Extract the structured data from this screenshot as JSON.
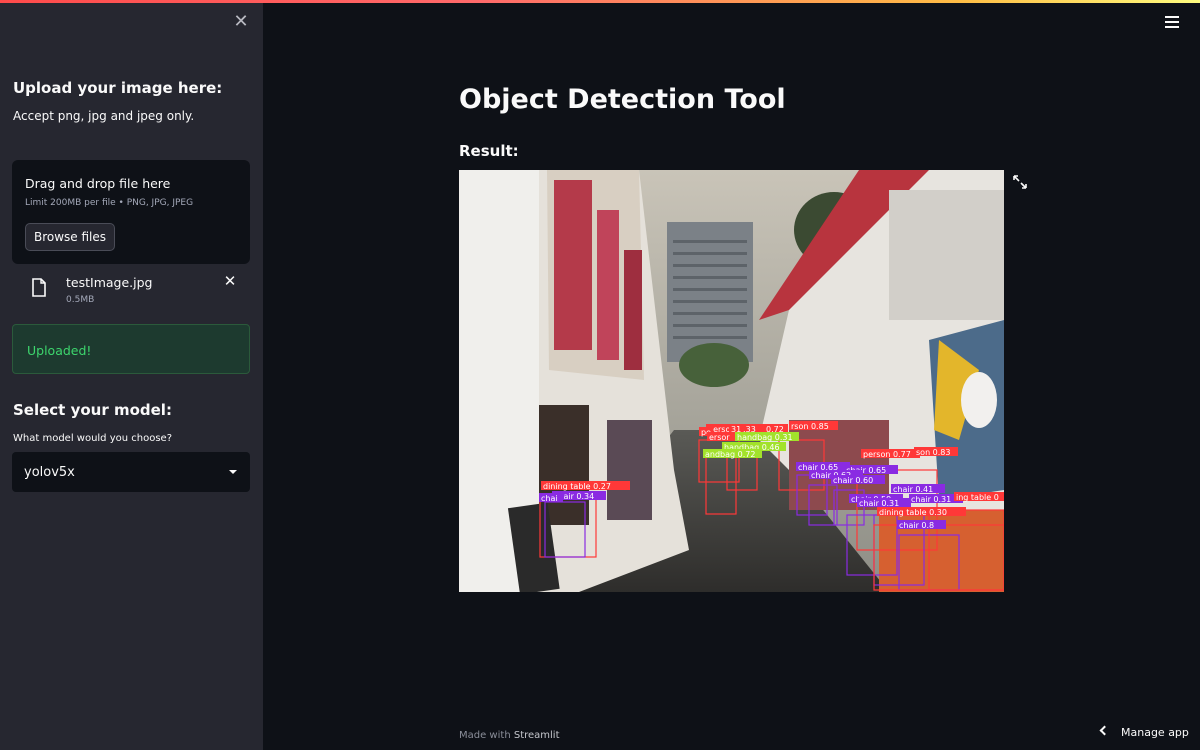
{
  "sidebar": {
    "close_icon": "close-icon",
    "upload_heading": "Upload your image here:",
    "upload_desc": "Accept png, jpg and jpeg only.",
    "dropzone": {
      "title": "Drag and drop file here",
      "limit": "Limit 200MB per file • PNG, JPG, JPEG",
      "browse_label": "Browse files"
    },
    "file": {
      "name": "testImage.jpg",
      "size": "0.5MB"
    },
    "success_text": "Uploaded!",
    "model_heading": "Select your model:",
    "model_label": "What model would you choose?",
    "model_value": "yolov5x"
  },
  "main": {
    "title": "Object Detection Tool",
    "result_label": "Result:",
    "image": {
      "description_icon": "street-photo-with-detections",
      "detections": [
        {
          "label": "dining table 0.27",
          "color": "#ff3838"
        },
        {
          "label": "chair 0.34",
          "color": "#8a2be2"
        },
        {
          "label": "chai",
          "color": "#8a2be2"
        },
        {
          "label": "person 0.33",
          "color": "#ff3838"
        },
        {
          "label": "0.72",
          "color": "#ff3838"
        },
        {
          "label": "31",
          "color": "#ff3838"
        },
        {
          "label": "rson 0.85",
          "color": "#ff3838"
        },
        {
          "label": "pe",
          "color": "#ff3838"
        },
        {
          "label": "ersor",
          "color": "#ff3838"
        },
        {
          "label": "handbag 0.31",
          "color": "#a2e22b"
        },
        {
          "label": "handbag 0.46",
          "color": "#a2e22b"
        },
        {
          "label": "andbag 0.72",
          "color": "#a2e22b"
        },
        {
          "label": "chair 0.65",
          "color": "#8a2be2"
        },
        {
          "label": "chair 0.65",
          "color": "#8a2be2"
        },
        {
          "label": "chair 0.62",
          "color": "#8a2be2"
        },
        {
          "label": "chair 0.60",
          "color": "#8a2be2"
        },
        {
          "label": "person 0.77",
          "color": "#ff3838"
        },
        {
          "label": "son 0.83",
          "color": "#ff3838"
        },
        {
          "label": "chair 0.41",
          "color": "#8a2be2"
        },
        {
          "label": "chair 0.59",
          "color": "#8a2be2"
        },
        {
          "label": "chair 0.31",
          "color": "#8a2be2"
        },
        {
          "label": "chair 0.31",
          "color": "#8a2be2"
        },
        {
          "label": "ing table 0",
          "color": "#ff3838"
        },
        {
          "label": "dining table 0.30",
          "color": "#ff3838"
        },
        {
          "label": "chair 0.8",
          "color": "#8a2be2"
        }
      ]
    },
    "fullscreen_icon": "expand-icon",
    "menu_icon": "hamburger-icon"
  },
  "footer": {
    "made_with": "Made with ",
    "brand": "Streamlit"
  },
  "manage_app": {
    "label": "Manage app",
    "icon": "chevron-left-icon"
  }
}
